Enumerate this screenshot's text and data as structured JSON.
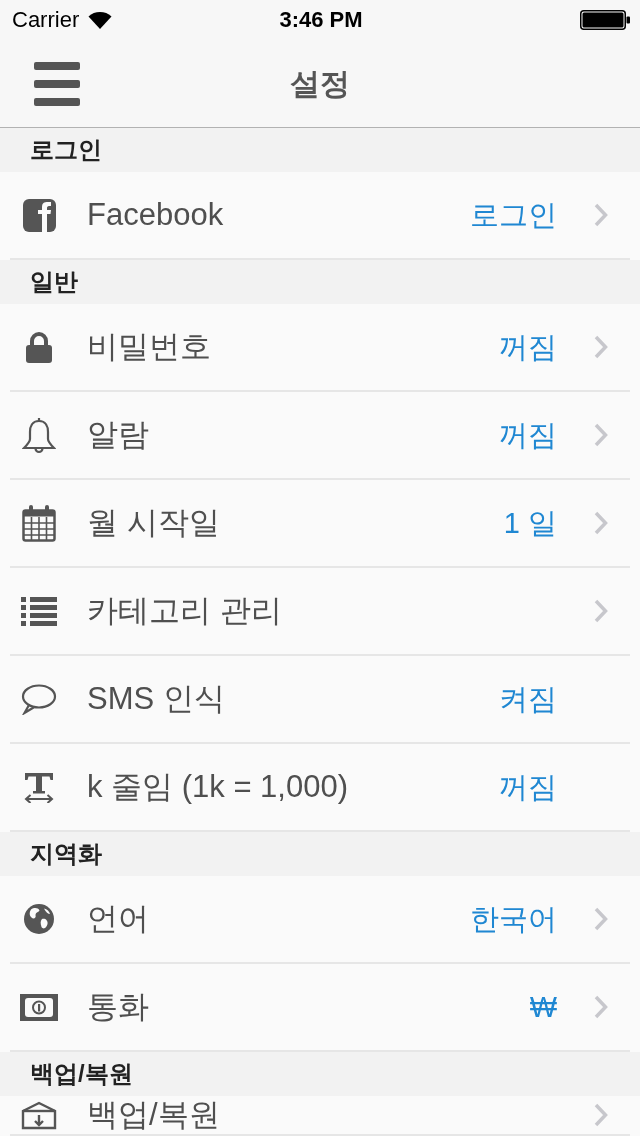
{
  "status_bar": {
    "carrier": "Carrier",
    "time": "3:46 PM"
  },
  "nav_bar": {
    "title": "설정"
  },
  "sections": [
    {
      "header": "로그인",
      "rows": [
        {
          "kind": "account",
          "label": "Facebook",
          "value": "로그인",
          "disclosure": true
        }
      ]
    },
    {
      "header": "일반",
      "rows": [
        {
          "kind": "password",
          "label": "비밀번호",
          "value": "꺼짐",
          "disclosure": true
        },
        {
          "kind": "alarm",
          "label": "알람",
          "value": "꺼짐",
          "disclosure": true
        },
        {
          "kind": "calendar",
          "label": "월 시작일",
          "value": "1 일",
          "disclosure": true
        },
        {
          "kind": "categories",
          "label": "카테고리 관리",
          "disclosure": true
        },
        {
          "kind": "sms",
          "label": "SMS 인식",
          "value": "켜짐",
          "disclosure": false
        },
        {
          "kind": "shorthand",
          "label": "k 줄임 (1k = 1,000)",
          "value": "꺼짐",
          "disclosure": false
        }
      ]
    },
    {
      "header": "지역화",
      "rows": [
        {
          "kind": "language",
          "label": "언어",
          "value": "한국어",
          "disclosure": true
        },
        {
          "kind": "currency",
          "label": "통화",
          "value": "₩",
          "disclosure": true
        }
      ]
    },
    {
      "header": "백업/복원",
      "rows": [
        {
          "kind": "backup",
          "label": "백업/복원",
          "disclosure": true
        }
      ]
    }
  ]
}
